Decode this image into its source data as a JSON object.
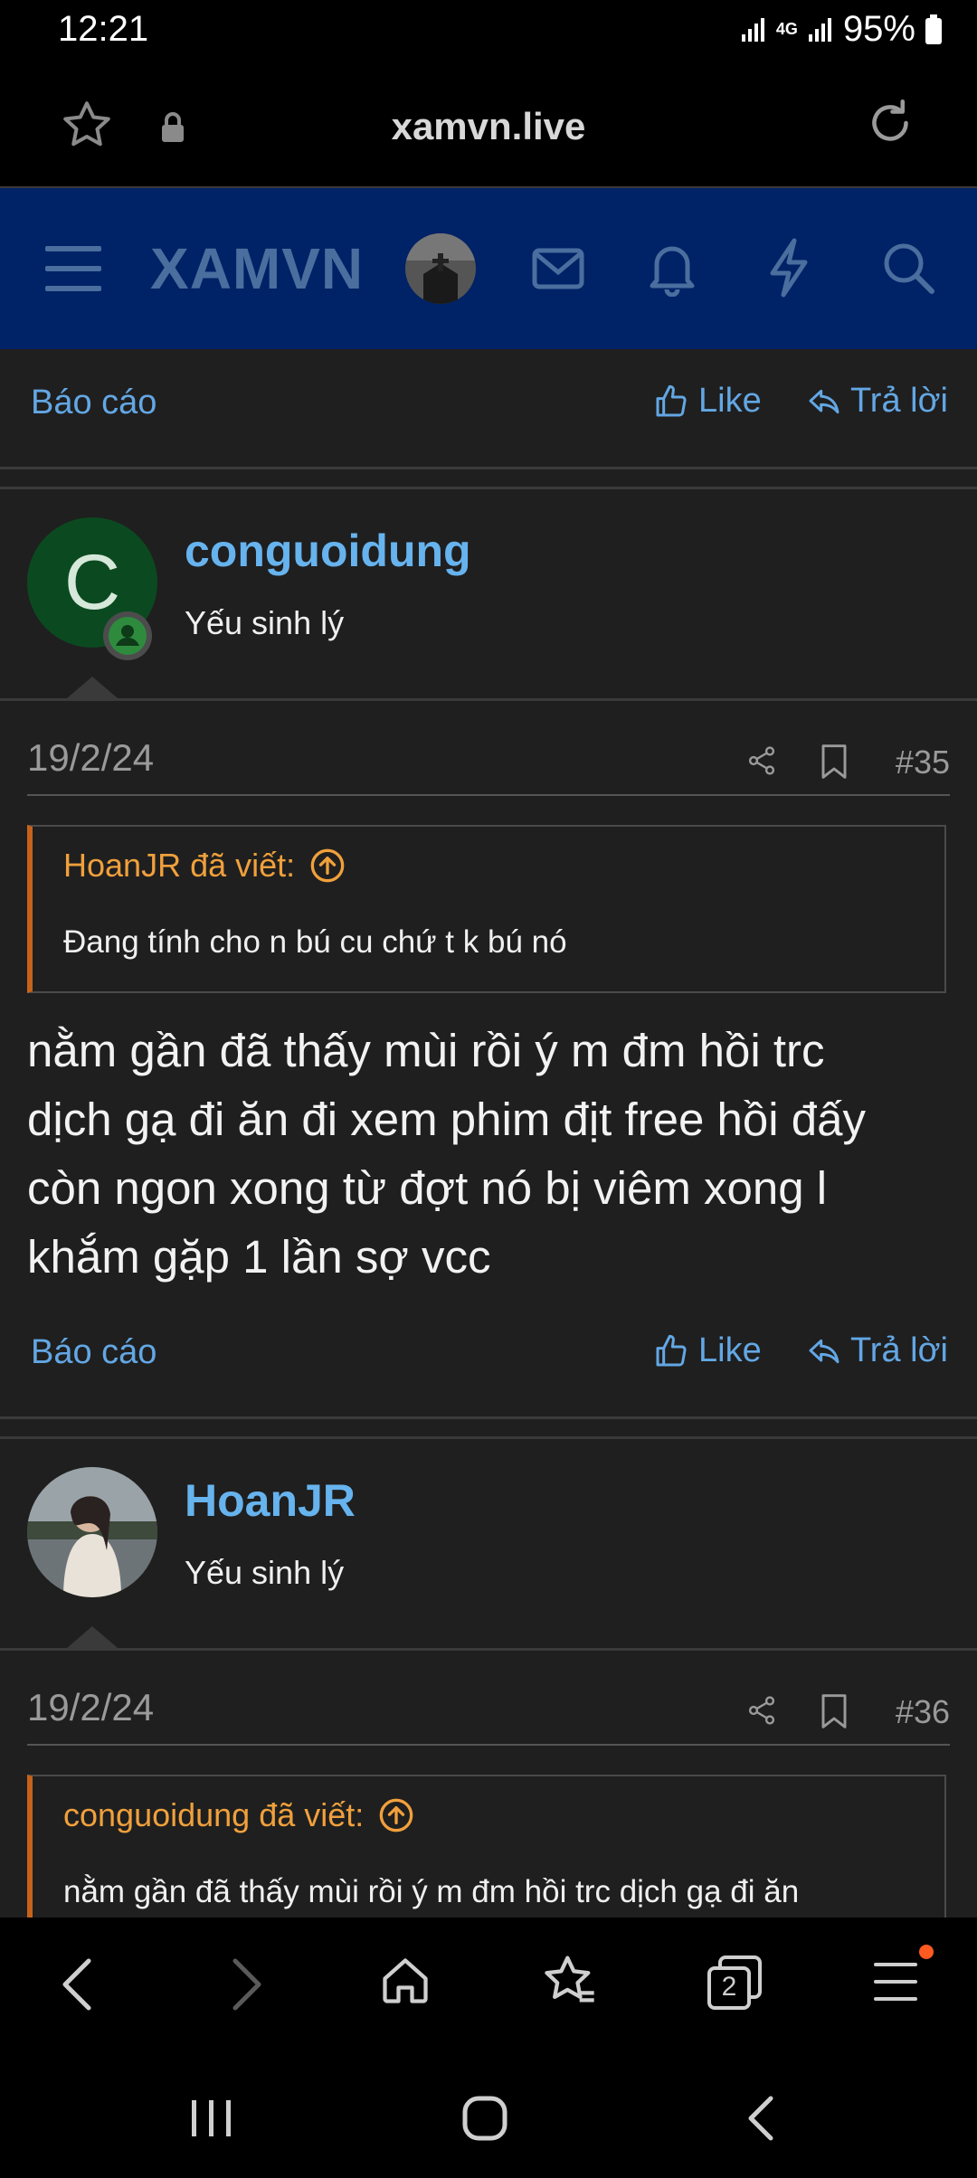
{
  "status_bar": {
    "time": "12:21",
    "network": "4G",
    "battery": "95%"
  },
  "browser": {
    "url": "xamvn.live",
    "tab_count": "2"
  },
  "site": {
    "logo": "XAMVN"
  },
  "actions": {
    "report": "Báo cáo",
    "like": "Like",
    "reply": "Trả lời"
  },
  "posts": [
    {
      "username": "conguoidung",
      "user_title": "Yếu sinh lý",
      "avatar_letter": "C",
      "date": "19/2/24",
      "number": "#35",
      "quote_author": "HoanJR đã viết:",
      "quote_text": "Đang tính cho n bú cu chứ t k bú nó",
      "body_lines": [
        "nằm gần đã thấy mùi rồi ý m đm hồi trc",
        "dịch gạ đi ăn đi xem phim địt free hồi đấy",
        "còn ngon xong từ đợt nó bị viêm xong l",
        "khắm gặp 1 lần sợ vcc"
      ]
    },
    {
      "username": "HoanJR",
      "user_title": "Yếu sinh lý",
      "date": "19/2/24",
      "number": "#36",
      "quote_author": "conguoidung đã viết:",
      "quote_text": "nằm gần đã thấy mùi rồi ý m đm hồi trc dịch gạ đi ăn"
    }
  ],
  "colors": {
    "header_bg": "#002266",
    "link": "#63a7e4",
    "quote_accent": "#f0a03c",
    "username": "#66b3ee"
  }
}
